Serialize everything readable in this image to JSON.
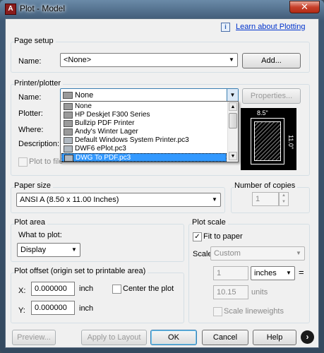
{
  "window": {
    "title": "Plot - Model",
    "close_glyph": "✕"
  },
  "help_link": {
    "label": "Learn about Plotting"
  },
  "page_setup": {
    "section": "Page setup",
    "name_label": "Name:",
    "name_value": "<None>",
    "add_button": "Add..."
  },
  "printer": {
    "section": "Printer/plotter",
    "name_label": "Name:",
    "name_value": "None",
    "properties_button": "Properties...",
    "plotter_label": "Plotter:",
    "where_label": "Where:",
    "description_label": "Description:",
    "plot_to_file_label": "Plot to file",
    "options": [
      "None",
      "HP Deskjet F300 Series",
      "Bullzip PDF Printer",
      "Andy's Winter Lager",
      "Default Windows System Printer.pc3",
      "DWF6 ePlot.pc3",
      "DWG To PDF.pc3"
    ],
    "selected_index": 6,
    "preview_width": "8.5\"",
    "preview_height": "11.0\""
  },
  "paper_size": {
    "section": "Paper size",
    "value": "ANSI A (8.50 x 11.00 Inches)"
  },
  "copies": {
    "section": "Number of copies",
    "value": "1"
  },
  "plot_area": {
    "section": "Plot area",
    "what_label": "What to plot:",
    "what_value": "Display"
  },
  "plot_offset": {
    "section": "Plot offset (origin set to printable area)",
    "x_label": "X:",
    "x_value": "0.000000",
    "x_unit": "inch",
    "y_label": "Y:",
    "y_value": "0.000000",
    "y_unit": "inch",
    "center_label": "Center the plot"
  },
  "plot_scale": {
    "section": "Plot scale",
    "fit_label": "Fit to paper",
    "fit_checked": true,
    "scale_label": "Scale:",
    "scale_value": "Custom",
    "value1": "1",
    "unit_value": "inches",
    "equals": "=",
    "value2": "10.15",
    "units_label": "units",
    "lineweights_label": "Scale lineweights"
  },
  "footer": {
    "preview": "Preview...",
    "apply": "Apply to Layout",
    "ok": "OK",
    "cancel": "Cancel",
    "help": "Help",
    "expand_glyph": "›"
  },
  "colors": {
    "link": "#0033cc",
    "selection": "#3399ff"
  }
}
